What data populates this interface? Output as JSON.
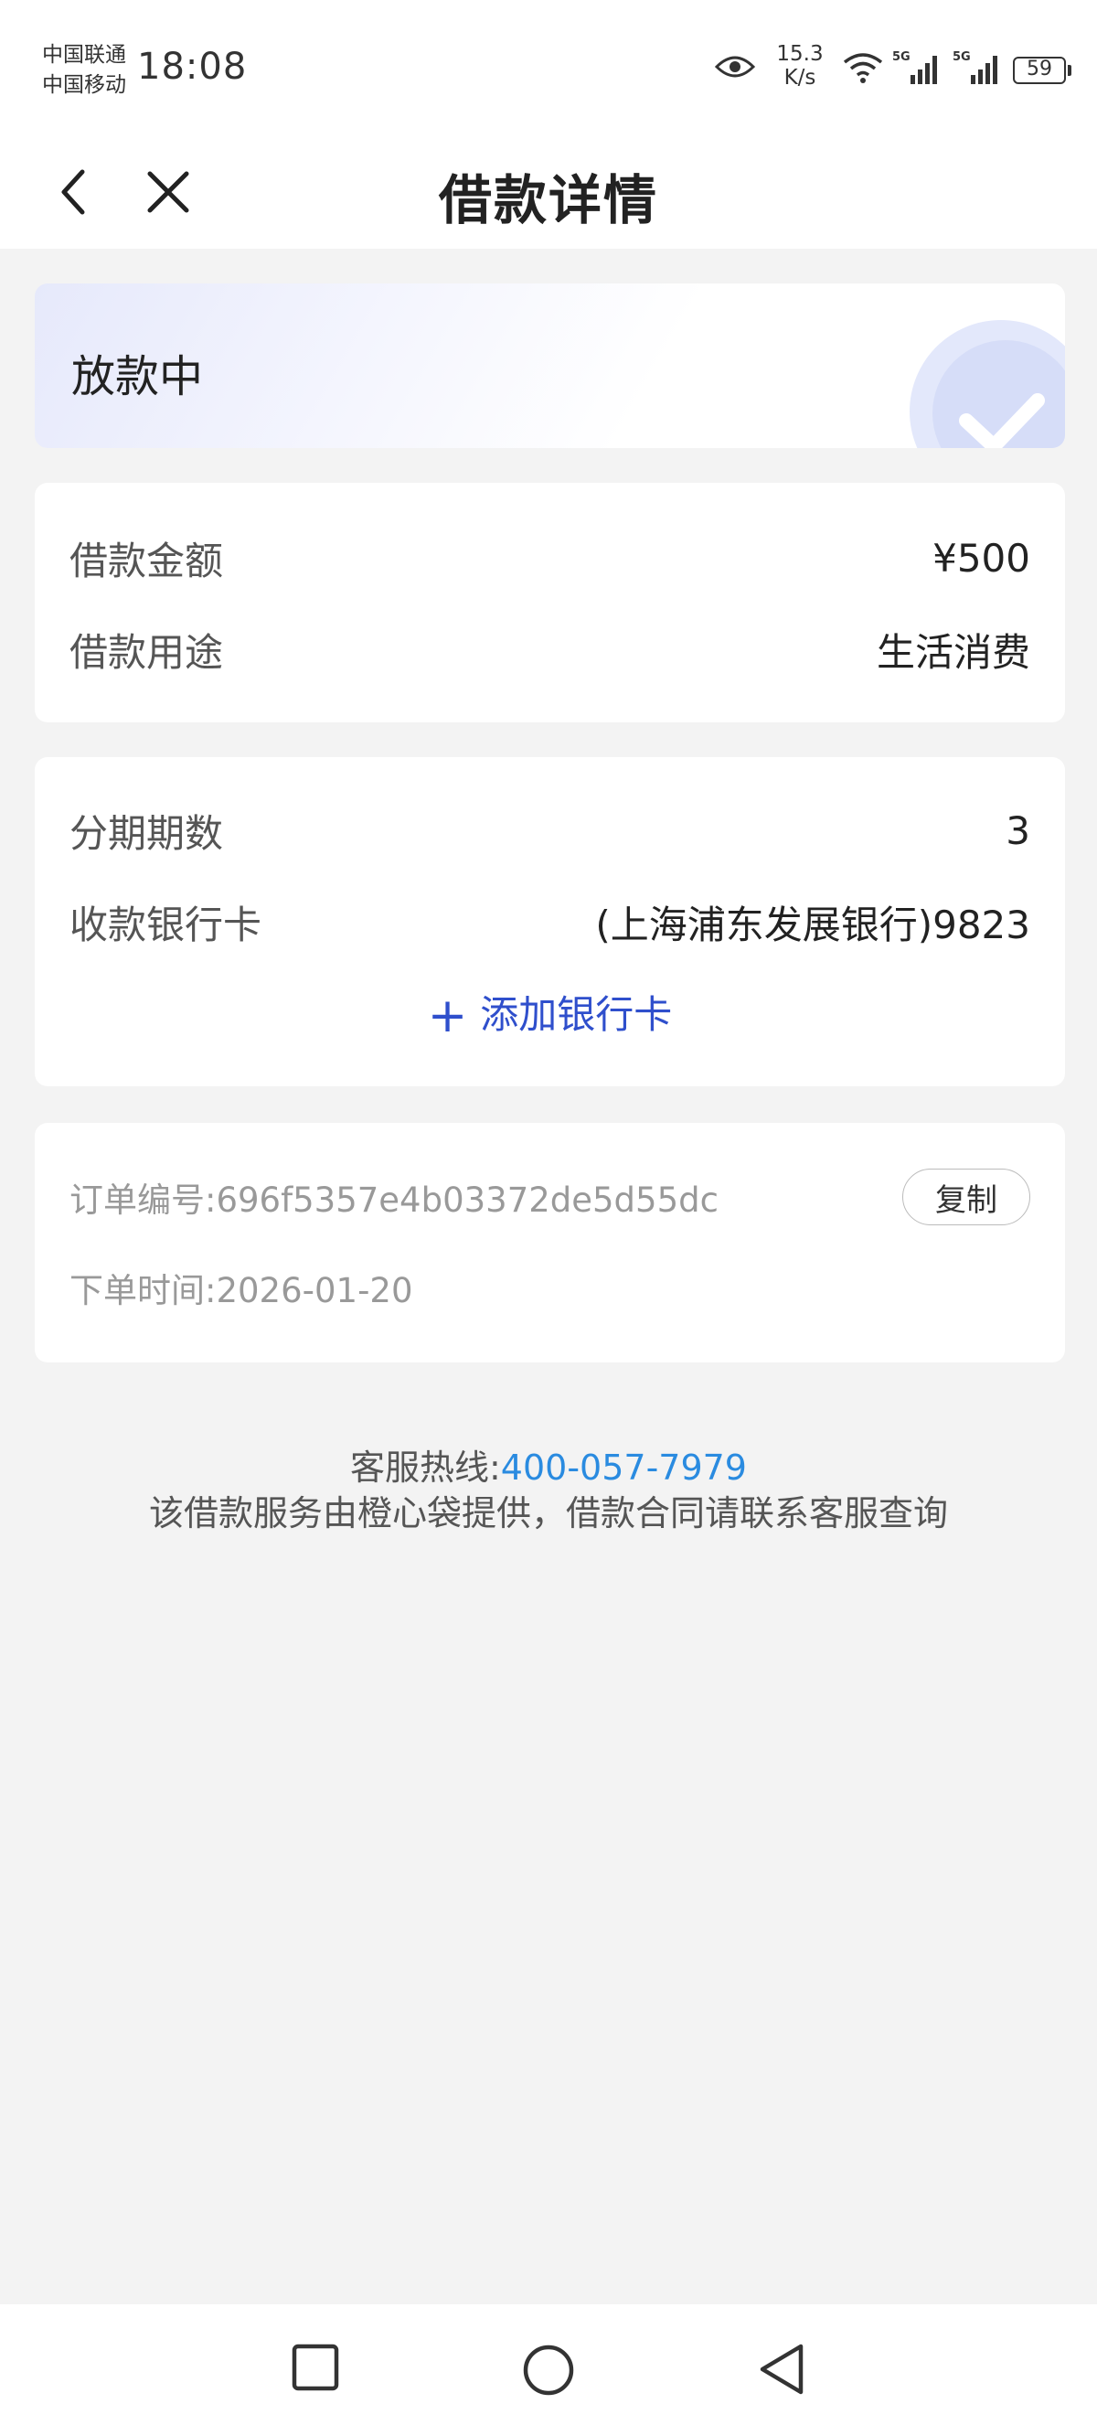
{
  "status_bar": {
    "carrier_1": "中国联通",
    "carrier_2": "中国移动",
    "time": "18:08",
    "net_speed_value": "15.3",
    "net_speed_unit": "K/s",
    "network_type_1": "5G",
    "network_type_2": "5G",
    "battery": "59",
    "icons": [
      "eye-icon",
      "wifi-icon",
      "signal-icon",
      "signal-icon"
    ]
  },
  "header": {
    "title": "借款详情",
    "back_icon": "chevron-left-icon",
    "close_icon": "close-icon"
  },
  "status_card": {
    "status": "放款中",
    "icon": "check-circle-icon"
  },
  "loan_info": {
    "amount_label": "借款金额",
    "amount_value": "¥500",
    "purpose_label": "借款用途",
    "purpose_value": "生活消费"
  },
  "installment_info": {
    "periods_label": "分期期数",
    "periods_value": "3",
    "bank_card_label": "收款银行卡",
    "bank_card_value": "(上海浦东发展银行)9823",
    "add_card_plus": "+",
    "add_card_label": "添加银行卡"
  },
  "order_info": {
    "order_no_label": "订单编号:",
    "order_no_value": "696f5357e4b03372de5d55dc",
    "copy_label": "复制",
    "order_time_label": "下单时间:",
    "order_time_value": "2026-01-20"
  },
  "footer": {
    "hotline_label": "客服热线:",
    "hotline_number": "400-057-7979",
    "notice": "该借款服务由橙心袋提供，借款合同请联系客服查询"
  },
  "colors": {
    "accent_blue": "#2f4fcc",
    "link_blue": "#2a8be0",
    "background": "#f3f3f3"
  }
}
